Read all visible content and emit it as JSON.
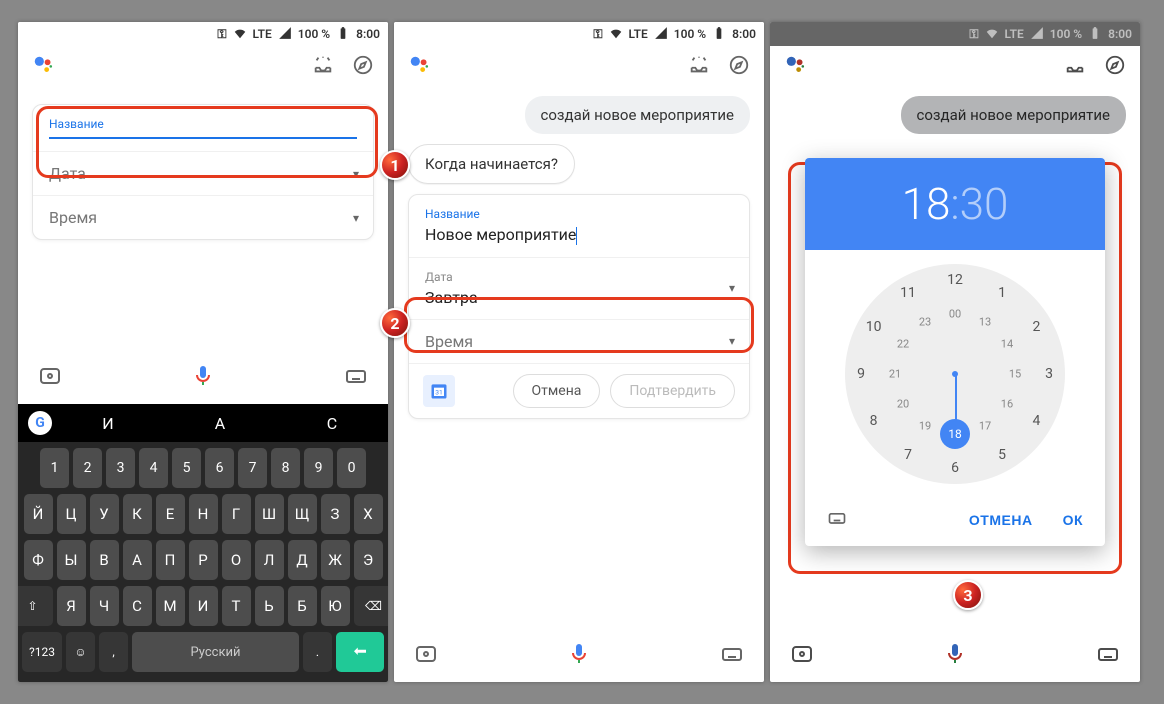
{
  "status": {
    "key": "⚿",
    "lte_label": "LTE",
    "battery": "100 %",
    "time": "8:00"
  },
  "chat": {
    "user_message": "создай новое мероприятие",
    "assistant_message": "Когда начинается?"
  },
  "form": {
    "title_label": "Название",
    "title_value": "Новое мероприятие",
    "date_label": "Дата",
    "date_value": "Завтра",
    "time_label": "Время",
    "cancel": "Отмена",
    "confirm": "Подтвердить"
  },
  "time_picker": {
    "hour": "18",
    "minute": "30",
    "outer_hours": [
      "12",
      "1",
      "2",
      "3",
      "4",
      "5",
      "6",
      "7",
      "8",
      "9",
      "10",
      "11"
    ],
    "inner_hours": [
      "00",
      "13",
      "14",
      "15",
      "16",
      "17",
      "18",
      "19",
      "20",
      "21",
      "22",
      "23"
    ],
    "selected": "18",
    "cancel": "ОТМЕНА",
    "ok": "ОК"
  },
  "keyboard": {
    "suggestions": [
      "И",
      "А",
      "С"
    ],
    "row_nums": [
      "1",
      "2",
      "3",
      "4",
      "5",
      "6",
      "7",
      "8",
      "9",
      "0"
    ],
    "row1": [
      "Й",
      "Ц",
      "У",
      "К",
      "Е",
      "Н",
      "Г",
      "Ш",
      "Щ",
      "З",
      "Х"
    ],
    "row2": [
      "Ф",
      "Ы",
      "В",
      "А",
      "П",
      "Р",
      "О",
      "Л",
      "Д",
      "Ж",
      "Э"
    ],
    "row3": [
      "Я",
      "Ч",
      "С",
      "М",
      "И",
      "Т",
      "Ь",
      "Б",
      "Ю"
    ],
    "sym": "?123",
    "lang": "Русский"
  },
  "callouts": {
    "c1": "1",
    "c2": "2",
    "c3": "3"
  }
}
